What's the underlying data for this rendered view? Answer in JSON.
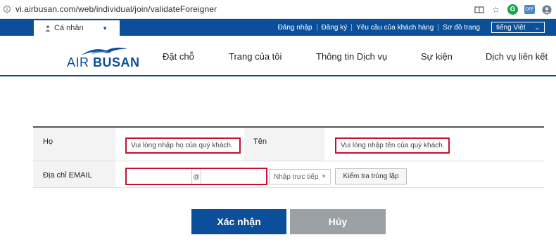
{
  "browser": {
    "url": "vi.airbusan.com/web/individual/join/validateForeigner",
    "ext_badge": "OFF"
  },
  "topbar": {
    "persona_label": "Cá nhân",
    "links": [
      "Đăng nhập",
      "Đăng ký",
      "Yêu cầu của khách hàng",
      "Sơ đồ trang"
    ],
    "language": "tiếng Việt"
  },
  "logo": {
    "text_air": "AIR",
    "text_busan": "BUSAN"
  },
  "nav": [
    "Đặt chỗ",
    "Trang của tôi",
    "Thông tin Dịch vụ",
    "Sự kiện",
    "Dịch vụ liên kết"
  ],
  "form": {
    "last_name_label": "Họ",
    "last_name_placeholder": "Vui lòng nhập họ của quý khách.",
    "first_name_label": "Tên",
    "first_name_placeholder": "Vui lòng nhập tên của quý khách.",
    "email_label": "Địa chỉ EMAIL",
    "email_at": "@",
    "domain_option": "Nhập trực tiếp",
    "duplicate_check": "Kiểm tra trùng lặp"
  },
  "buttons": {
    "confirm": "Xác nhận",
    "cancel": "Hủy"
  },
  "colors": {
    "brand_blue": "#0b4f9a",
    "highlight_red": "#c8102e",
    "cancel_gray": "#9aa0a3"
  }
}
